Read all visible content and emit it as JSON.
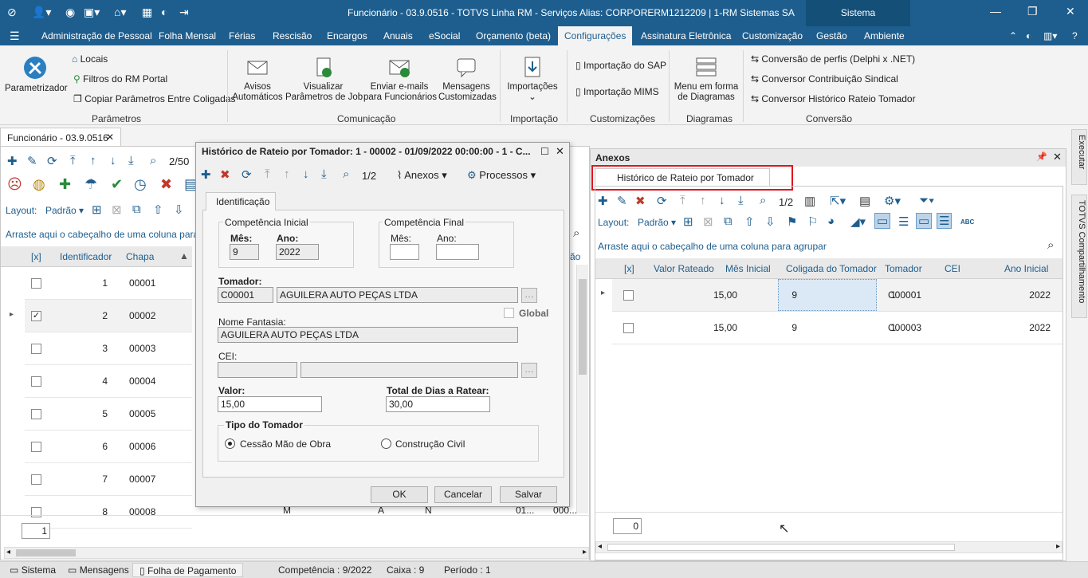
{
  "titlebar": {
    "title": "Funcionário - 03.9.0516 - TOTVS Linha RM - Serviços  Alias: CORPORERM1212209 | 1-RM Sistemas SA",
    "sistema": "Sistema"
  },
  "menu": {
    "items": [
      "Administração de Pessoal",
      "Folha Mensal",
      "Férias",
      "Rescisão",
      "Encargos",
      "Anuais",
      "eSocial",
      "Orçamento (beta)",
      "Configurações",
      "Assinatura Eletrônica",
      "Customização",
      "Gestão",
      "Ambiente"
    ],
    "active": "Configurações"
  },
  "ribbon": {
    "parametrizador": "Parametrizador",
    "locais": "Locais",
    "filtros": "Filtros do RM Portal",
    "copiar": "Copiar Parâmetros Entre Coligadas",
    "group_parametros": "Parâmetros",
    "avisos": [
      "Avisos",
      "Automáticos"
    ],
    "visualizar": [
      "Visualizar",
      "Parâmetros de Job"
    ],
    "enviar": [
      "Enviar e-mails",
      "para Funcionários"
    ],
    "mensagens": [
      "Mensagens",
      "Customizadas"
    ],
    "group_comunicacao": "Comunicação",
    "importacoes": "Importações",
    "group_importacao": "Importação",
    "imp_sap": "Importação do SAP",
    "imp_mims": "Importação MIMS",
    "group_customizacoes": "Customizações",
    "menu_diagramas": [
      "Menu em forma",
      "de Diagramas"
    ],
    "group_diagramas": "Diagramas",
    "conv_perfis": "Conversão de perfis (Delphi x .NET)",
    "conv_sindical": "Conversor Contribuição Sindical",
    "conv_rateio": "Conversor Histórico Rateio Tomador",
    "group_conversao": "Conversão"
  },
  "doc_tab": "Funcionário - 03.9.0516",
  "left": {
    "pager": "2/50",
    "layout_label": "Layout:",
    "layout_value": "Padrão",
    "group_hint": "Arraste aqui o cabeçalho de uma coluna para agrupar",
    "col_check": "[x]",
    "col_id": "Identificador",
    "col_chapa": "Chapa",
    "rows": [
      {
        "id": "1",
        "chapa": "00001",
        "checked": false
      },
      {
        "id": "2",
        "chapa": "00002",
        "checked": true
      },
      {
        "id": "3",
        "chapa": "00003",
        "checked": false
      },
      {
        "id": "4",
        "chapa": "00004",
        "checked": false
      },
      {
        "id": "5",
        "chapa": "00005",
        "checked": false
      },
      {
        "id": "6",
        "chapa": "00006",
        "checked": false
      },
      {
        "id": "7",
        "chapa": "00007",
        "checked": false
      },
      {
        "id": "8",
        "chapa": "00008",
        "checked": false
      }
    ],
    "row8_extra": [
      "M",
      "A",
      "N",
      "01...",
      "000..."
    ],
    "count": "1",
    "col_partial": "ão"
  },
  "dialog": {
    "title": "Histórico de Rateio por Tomador: 1 - 00002 - 01/09/2022 00:00:00 - 1 - C...",
    "pager": "1/2",
    "anexos": "Anexos",
    "processos": "Processos",
    "tab": "Identificação",
    "comp_inicial": "Competência Inicial",
    "comp_final": "Competência Final",
    "mes_label": "Mês:",
    "ano_label": "Ano:",
    "mes_ini": "9",
    "ano_ini": "2022",
    "mes_fim": "",
    "ano_fim": "",
    "tomador_label": "Tomador:",
    "tomador_code": "C00001",
    "tomador_name": "AGUILERA AUTO PEÇAS LTDA",
    "global": "Global",
    "fantasia_label": "Nome Fantasia:",
    "fantasia": "AGUILERA AUTO PEÇAS LTDA",
    "cei_label": "CEI:",
    "valor_label": "Valor:",
    "valor": "15,00",
    "dias_label": "Total de Dias a Ratear:",
    "dias": "30,00",
    "tipo_label": "Tipo do Tomador",
    "opt1": "Cessão Mão de Obra",
    "opt2": "Construção Civil",
    "ok": "OK",
    "cancelar": "Cancelar",
    "salvar": "Salvar"
  },
  "right": {
    "title": "Anexos",
    "tab": "Histórico de Rateio por Tomador",
    "pager": "1/2",
    "layout_label": "Layout:",
    "layout_value": "Padrão",
    "group_hint": "Arraste aqui o cabeçalho de uma coluna para agrupar",
    "cols": [
      "[x]",
      "Valor Rateado",
      "Mês Inicial",
      "Coligada do Tomador",
      "Tomador",
      "CEI",
      "Ano Inicial"
    ],
    "rows": [
      {
        "valor": "15,00",
        "mes": "9",
        "coligada": "1",
        "tomador": "C00001",
        "cei": "",
        "ano": "2022"
      },
      {
        "valor": "15,00",
        "mes": "9",
        "coligada": "1",
        "tomador": "C00003",
        "cei": "",
        "ano": "2022"
      }
    ],
    "count": "0",
    "highlight_color": "#e0141e"
  },
  "side": {
    "executar": "Executar",
    "compartilhamento": "TOTVS Compartilhamento"
  },
  "status": {
    "sistema": "Sistema",
    "mensagens": "Mensagens",
    "folha": "Folha de Pagamento",
    "competencia": "Competência : 9/2022",
    "caixa": "Caixa : 9",
    "periodo": "Período : 1"
  }
}
